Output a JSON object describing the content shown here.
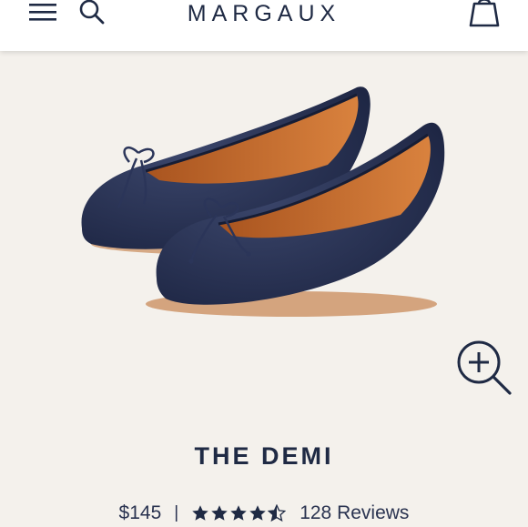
{
  "header": {
    "logo": "MARGAUX",
    "menu_icon": "hamburger-menu-icon",
    "search_icon": "search-icon",
    "bag_icon": "shopping-bag-icon"
  },
  "hero": {
    "zoom_icon": "zoom-in-icon",
    "shoe_color": "#232c4a",
    "background_color": "#f4f1ec"
  },
  "product": {
    "title": "THE DEMI",
    "price": "$145",
    "separator": "|",
    "rating_stars": 4.5,
    "reviews": "128 Reviews"
  }
}
